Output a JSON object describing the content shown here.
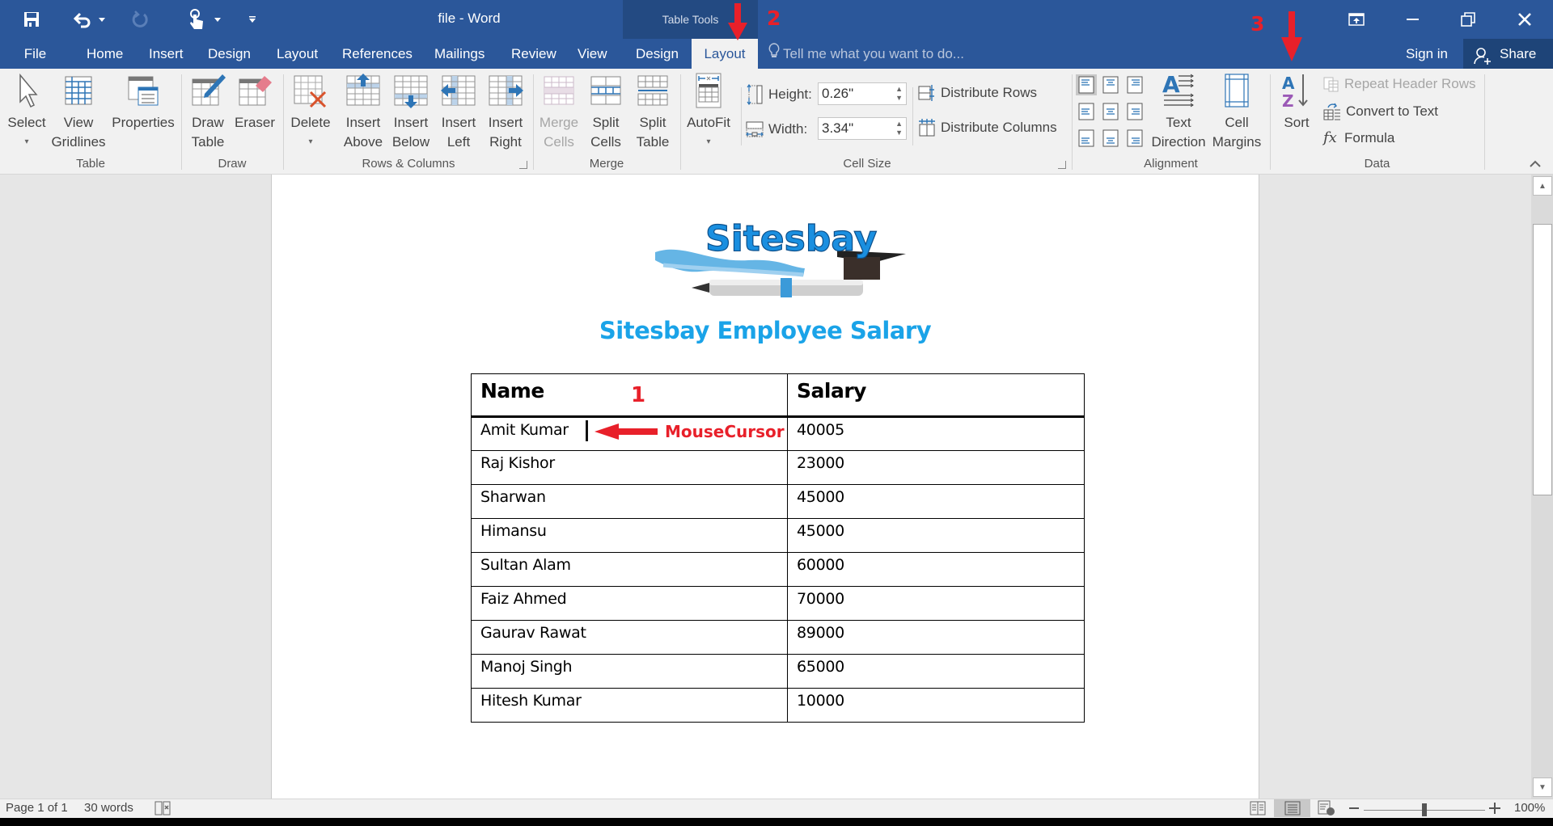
{
  "window": {
    "title": "file - Word",
    "context_group": "Table Tools",
    "controls": {
      "ribbon_display": "ribbon-display-options-icon",
      "minimize": "minimize-icon",
      "restore": "restore-icon",
      "close": "close-icon"
    }
  },
  "quick_access": {
    "items": [
      {
        "icon": "save-icon"
      },
      {
        "icon": "undo-icon"
      },
      {
        "icon": "redo-icon",
        "disabled": true
      },
      {
        "icon": "touch-mode-icon"
      },
      {
        "icon": "customize-qat-icon"
      }
    ]
  },
  "tabs": [
    {
      "label": "File"
    },
    {
      "label": "Home"
    },
    {
      "label": "Insert"
    },
    {
      "label": "Design"
    },
    {
      "label": "Layout"
    },
    {
      "label": "References"
    },
    {
      "label": "Mailings"
    },
    {
      "label": "Review"
    },
    {
      "label": "View"
    },
    {
      "label": "Design",
      "context": "Table Tools"
    },
    {
      "label": "Layout",
      "context": "Table Tools",
      "active": true
    }
  ],
  "tell_me": {
    "placeholder": "Tell me what you want to do..."
  },
  "account": {
    "sign_in": "Sign in",
    "share": "Share"
  },
  "ribbon": {
    "groups": {
      "table": {
        "label": "Table",
        "select": {
          "line1": "Select",
          "line2": "▾"
        },
        "view_gridlines": {
          "line1": "View",
          "line2": "Gridlines"
        },
        "properties": {
          "line1": "Properties"
        }
      },
      "draw": {
        "label": "Draw",
        "draw_table": {
          "line1": "Draw",
          "line2": "Table"
        },
        "eraser": {
          "line1": "Eraser"
        }
      },
      "rows_columns": {
        "label": "Rows & Columns",
        "delete": {
          "line1": "Delete",
          "line2": "▾"
        },
        "insert_above": {
          "line1": "Insert",
          "line2": "Above"
        },
        "insert_below": {
          "line1": "Insert",
          "line2": "Below"
        },
        "insert_left": {
          "line1": "Insert",
          "line2": "Left"
        },
        "insert_right": {
          "line1": "Insert",
          "line2": "Right"
        }
      },
      "merge": {
        "label": "Merge",
        "merge_cells": {
          "line1": "Merge",
          "line2": "Cells",
          "disabled": true
        },
        "split_cells": {
          "line1": "Split",
          "line2": "Cells"
        },
        "split_table": {
          "line1": "Split",
          "line2": "Table"
        }
      },
      "cell_size": {
        "label": "Cell Size",
        "autofit": {
          "line1": "AutoFit",
          "line2": "▾"
        },
        "height_label": "Height:",
        "height_value": "0.26\"",
        "width_label": "Width:",
        "width_value": "3.34\"",
        "distribute_rows": "Distribute Rows",
        "distribute_columns": "Distribute Columns"
      },
      "alignment": {
        "label": "Alignment",
        "text_direction": {
          "line1": "Text",
          "line2": "Direction"
        },
        "cell_margins": {
          "line1": "Cell",
          "line2": "Margins"
        },
        "align_buttons": [
          "top-left",
          "top-center",
          "top-right",
          "middle-left",
          "middle-center",
          "middle-right",
          "bottom-left",
          "bottom-center",
          "bottom-right"
        ],
        "selected_align": "top-left"
      },
      "data": {
        "label": "Data",
        "sort": {
          "line1": "Sort"
        },
        "repeat_header_rows": {
          "label": "Repeat Header Rows",
          "disabled": true
        },
        "convert_to_text": "Convert to Text",
        "formula": "Formula"
      }
    }
  },
  "document": {
    "logo_text": "Sitesbay",
    "heading": "Sitesbay Employee Salary",
    "table": {
      "headers": [
        "Name",
        "Salary"
      ],
      "rows": [
        [
          "Amit Kumar",
          "40005"
        ],
        [
          "Raj Kishor",
          "23000"
        ],
        [
          "Sharwan",
          "45000"
        ],
        [
          "Himansu",
          "45000"
        ],
        [
          "Sultan Alam",
          "60000"
        ],
        [
          "Faiz Ahmed",
          "70000"
        ],
        [
          "Gaurav Rawat",
          "89000"
        ],
        [
          "Manoj Singh",
          "65000"
        ],
        [
          "Hitesh Kumar",
          "10000"
        ]
      ]
    }
  },
  "annotations": {
    "step1": "1",
    "step1_label": "MouseCursor",
    "step2": "2",
    "step3": "3",
    "color": "#e8202a"
  },
  "status_bar": {
    "page": "Page 1 of 1",
    "words": "30 words",
    "zoom_percent": "100%",
    "zoom_level": 100,
    "view_mode": "print-layout"
  },
  "colors": {
    "ribbon_blue": "#2b579a",
    "context_blue": "#234a82",
    "heading_blue": "#1aa3e8",
    "ribbon_bg": "#f1f1f1"
  }
}
